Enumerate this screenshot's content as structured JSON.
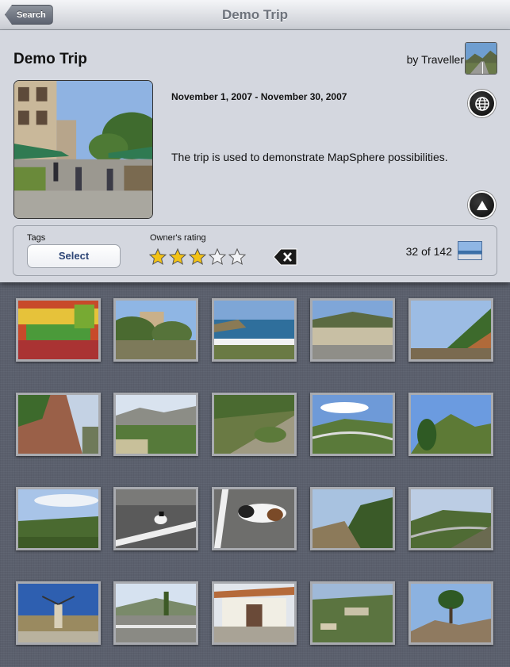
{
  "nav": {
    "back_label": "Search",
    "title": "Demo Trip"
  },
  "trip": {
    "name": "Demo Trip",
    "author": "by Traveller",
    "dates": "November 1, 2007 - November 30, 2007",
    "description": "The trip is used to demonstrate MapSphere possibilities."
  },
  "tags": {
    "label": "Tags",
    "select_label": "Select"
  },
  "rating": {
    "label": "Owner's rating",
    "value": 3,
    "max": 5,
    "star_color": "#f3c214"
  },
  "counter": {
    "text": "32 of 142"
  },
  "icons": {
    "globe": "globe-icon",
    "up": "up-arrow-icon",
    "clear": "clear-backspace-icon"
  },
  "photos": [
    {
      "name": "fruit-market"
    },
    {
      "name": "hillside-house"
    },
    {
      "name": "sea-bay"
    },
    {
      "name": "coast-road"
    },
    {
      "name": "rocky-slope"
    },
    {
      "name": "red-cliff"
    },
    {
      "name": "mountain-valley"
    },
    {
      "name": "green-hill"
    },
    {
      "name": "distant-hills"
    },
    {
      "name": "shrub-hills"
    },
    {
      "name": "valley-view"
    },
    {
      "name": "dog-on-road"
    },
    {
      "name": "dog-closeup"
    },
    {
      "name": "mountain-road"
    },
    {
      "name": "winding-road"
    },
    {
      "name": "windmill"
    },
    {
      "name": "village-street"
    },
    {
      "name": "taverna"
    },
    {
      "name": "village-hills"
    },
    {
      "name": "lone-tree"
    }
  ]
}
